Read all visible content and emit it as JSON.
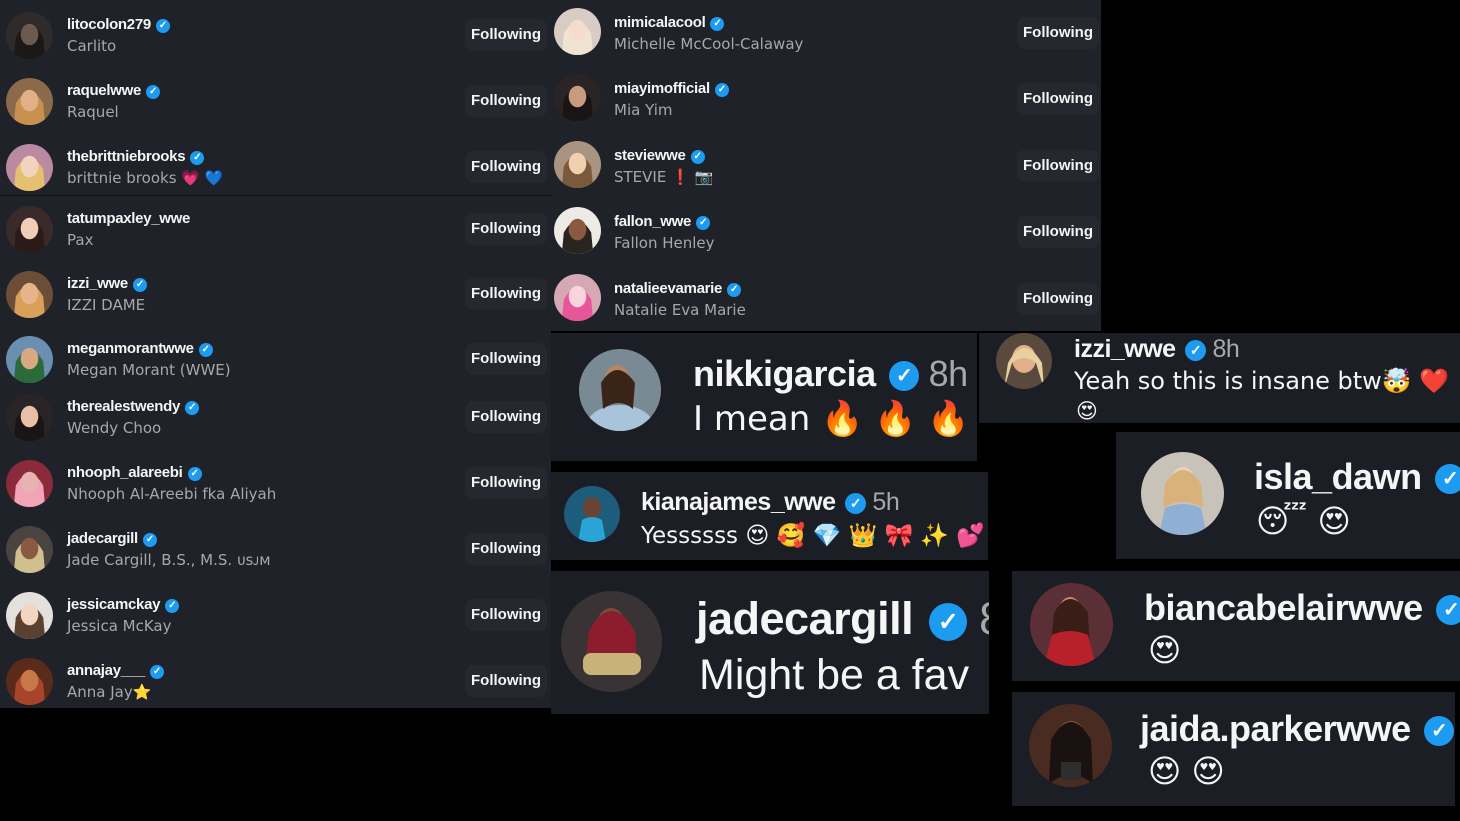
{
  "following_label": "Following",
  "left_list": [
    {
      "username": "litocolon279",
      "name": "Carlito",
      "verified": true
    },
    {
      "username": "raquelwwe",
      "name": "Raquel",
      "verified": true
    },
    {
      "username": "thebrittniebrooks",
      "name": "brittnie brooks 💗 💙",
      "verified": true
    },
    {
      "username": "tatumpaxley_wwe",
      "name": "Pax",
      "verified": false
    },
    {
      "username": "izzi_wwe",
      "name": "IZZI DAME",
      "verified": true
    },
    {
      "username": "meganmorantwwe",
      "name": "Megan Morant (WWE)",
      "verified": true
    },
    {
      "username": "therealestwendy",
      "name": "Wendy Choo",
      "verified": true
    },
    {
      "username": "nhooph_alareebi",
      "name": "Nhooph Al-Areebi fka Aliyah",
      "verified": true
    },
    {
      "username": "jadecargill",
      "name": "Jade Cargill, B.S., M.S. ᴜsᴊᴍ",
      "verified": true
    },
    {
      "username": "jessicamckay",
      "name": "Jessica McKay",
      "verified": true
    },
    {
      "username": "annajay___",
      "name": "Anna Jay⭐",
      "verified": true
    }
  ],
  "right_list": [
    {
      "username": "mimicalacool",
      "name": "Michelle McCool-Calaway",
      "verified": true
    },
    {
      "username": "miayimofficial",
      "name": "Mia Yim",
      "verified": true
    },
    {
      "username": "steviewwe",
      "name": "STEVIE ❗ 📷",
      "verified": true
    },
    {
      "username": "fallon_wwe",
      "name": "Fallon Henley",
      "verified": true
    },
    {
      "username": "natalieevamarie",
      "name": "Natalie Eva Marie",
      "verified": true
    }
  ],
  "comments": {
    "nikki": {
      "username": "nikkigarcia",
      "time": "8h",
      "text": "I mean 🔥 🔥 🔥"
    },
    "izzi": {
      "username": "izzi_wwe",
      "time": "8h",
      "text": "Yeah so this is insane btw🤯 ❤️ 🔥",
      "text2": "😍"
    },
    "kiana": {
      "username": "kianajames_wwe",
      "time": "5h",
      "text": "Yessssss 😍 🥰 💎 👑 🎀 ✨ 💕"
    },
    "isla": {
      "username": "isla_dawn",
      "text": "😴 😍"
    },
    "jade": {
      "username": "jadecargill",
      "time": "8",
      "text": "Might be a fav"
    },
    "bianca": {
      "username": "biancabelairwwe",
      "text": "😍"
    },
    "jaida": {
      "username": "jaida.parkerwwe",
      "text": "😍 😍"
    }
  },
  "colors": {
    "panel": "#1f2229",
    "button": "#25282f",
    "verified": "#1d9bf0",
    "muted": "#a8a8a8"
  }
}
